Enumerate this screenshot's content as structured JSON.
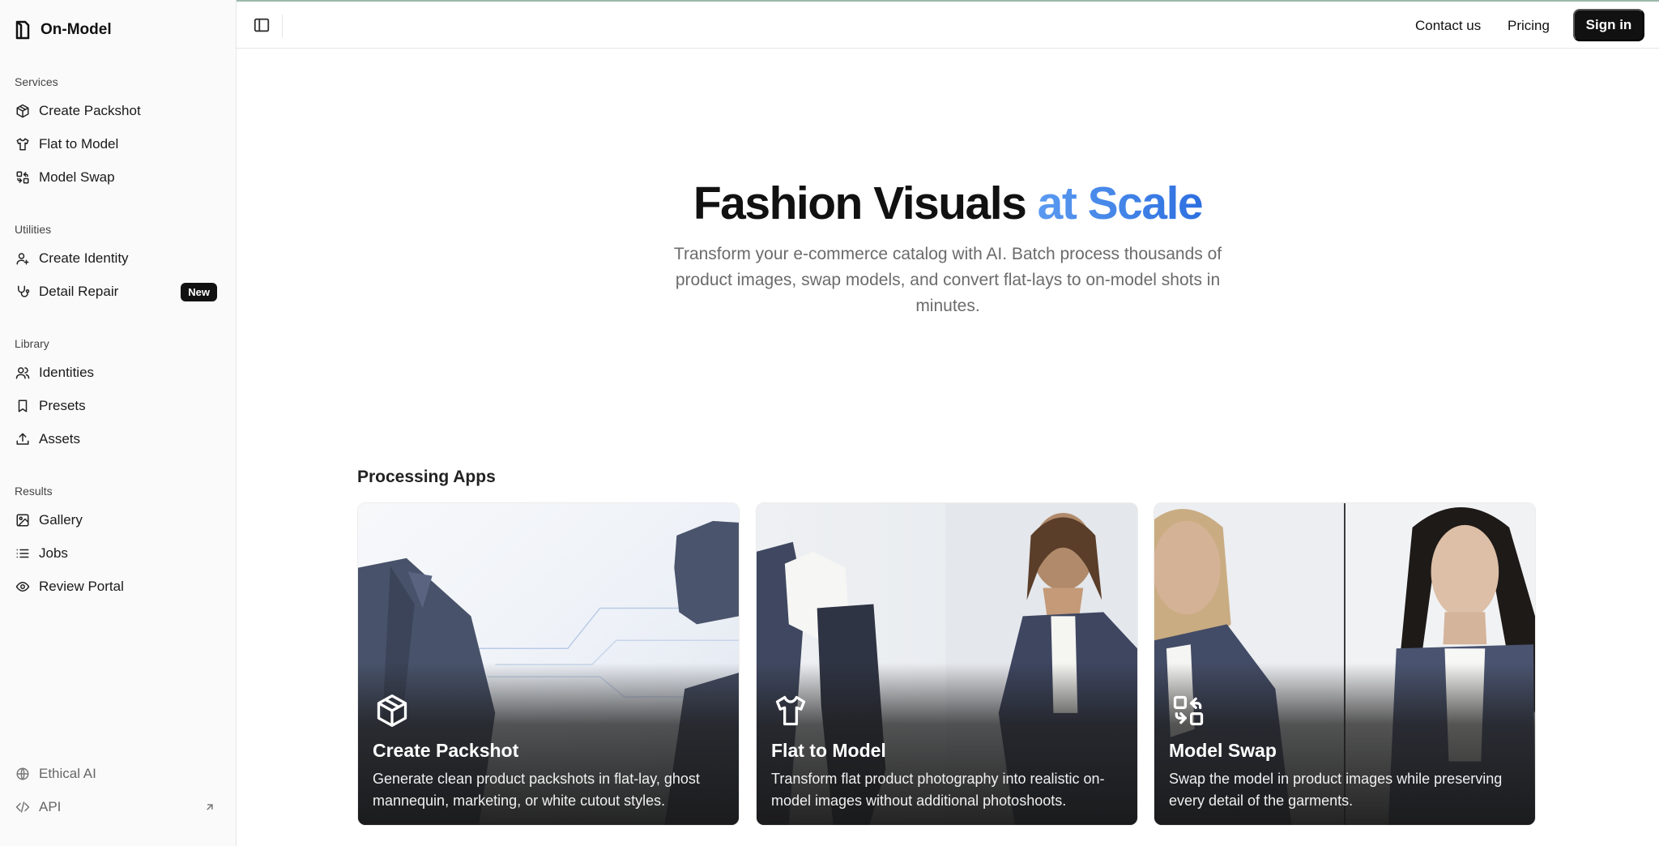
{
  "brand": {
    "name": "On-Model"
  },
  "sidebar": {
    "sections": [
      {
        "label": "Services",
        "items": [
          {
            "label": "Create Packshot",
            "icon": "package-icon"
          },
          {
            "label": "Flat to Model",
            "icon": "shirt-icon"
          },
          {
            "label": "Model Swap",
            "icon": "swap-icon"
          }
        ]
      },
      {
        "label": "Utilities",
        "items": [
          {
            "label": "Create Identity",
            "icon": "user-plus-icon"
          },
          {
            "label": "Detail Repair",
            "icon": "stethoscope-icon",
            "badge": "New"
          }
        ]
      },
      {
        "label": "Library",
        "items": [
          {
            "label": "Identities",
            "icon": "users-icon"
          },
          {
            "label": "Presets",
            "icon": "bookmark-icon"
          },
          {
            "label": "Assets",
            "icon": "upload-icon"
          }
        ]
      },
      {
        "label": "Results",
        "items": [
          {
            "label": "Gallery",
            "icon": "image-icon"
          },
          {
            "label": "Jobs",
            "icon": "list-icon"
          },
          {
            "label": "Review Portal",
            "icon": "eye-icon"
          }
        ]
      }
    ],
    "footer": [
      {
        "label": "Ethical AI",
        "icon": "globe-icon"
      },
      {
        "label": "API",
        "icon": "code-icon"
      }
    ]
  },
  "header": {
    "contact_label": "Contact us",
    "pricing_label": "Pricing",
    "signin_label": "Sign in"
  },
  "hero": {
    "title_main": "Fashion Visuals",
    "title_accent": "at Scale",
    "subtitle": "Transform your e-commerce catalog with AI. Batch process thousands of product images, swap models, and convert flat-lays to on-model shots in minutes.",
    "accent_colors": [
      "#5a9af0",
      "#2d6fe0"
    ]
  },
  "apps": {
    "title": "Processing Apps",
    "cards": [
      {
        "title": "Create Packshot",
        "description": "Generate clean product packshots in flat-lay, ghost mannequin, marketing, or white cutout styles.",
        "icon": "package-icon"
      },
      {
        "title": "Flat to Model",
        "description": "Transform flat product photography into realistic on-model images without additional photoshoots.",
        "icon": "shirt-icon"
      },
      {
        "title": "Model Swap",
        "description": "Swap the model in product images while preserving every detail of the garments.",
        "icon": "swap-icon"
      }
    ]
  }
}
